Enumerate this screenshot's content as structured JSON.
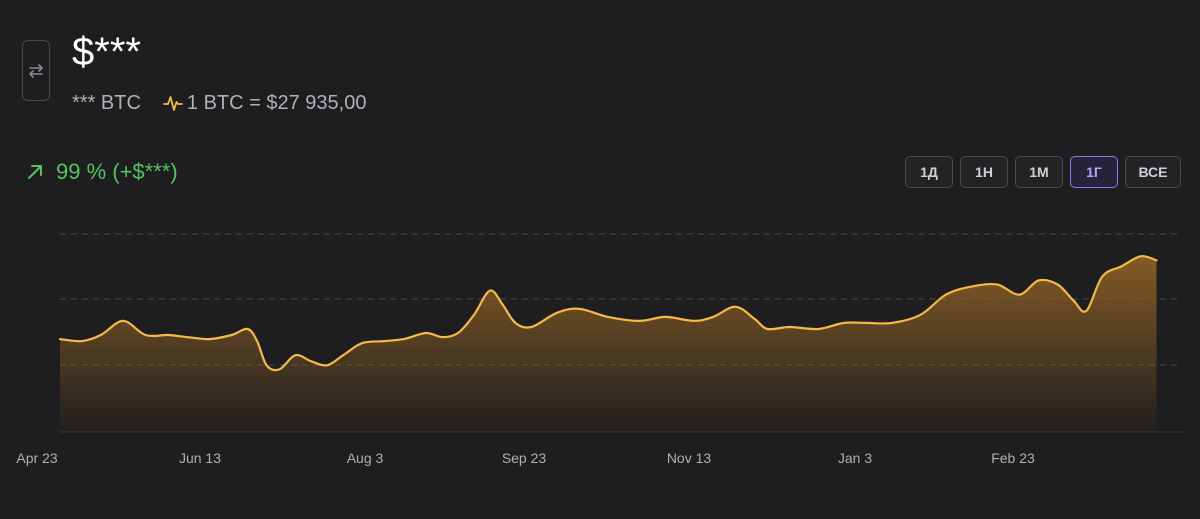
{
  "header": {
    "balance": "$***",
    "btc_amount": "*** BTC",
    "rate": "1 BTC = $27 935,00",
    "change": "99 % (+$***)"
  },
  "ranges": [
    {
      "label": "1Д",
      "active": false
    },
    {
      "label": "1Н",
      "active": false
    },
    {
      "label": "1М",
      "active": false
    },
    {
      "label": "1Г",
      "active": true
    },
    {
      "label": "ВСЕ",
      "active": false
    }
  ],
  "colors": {
    "line": "#f5b84a",
    "positive": "#53c45f",
    "accent": "#8b7ef0",
    "grid": "#4a4a4f"
  },
  "chart_data": {
    "type": "area",
    "title": "",
    "xlabel": "",
    "ylabel": "",
    "x_ticks": [
      "Apr 23",
      "Jun 13",
      "Aug 3",
      "Sep 23",
      "Nov 13",
      "Jan 3",
      "Feb 23"
    ],
    "x_tick_days": [
      0,
      51,
      102,
      153,
      204,
      255,
      306
    ],
    "x_range": [
      0,
      348
    ],
    "y_axis_labels": false,
    "grid": "horizontal dashed",
    "ylim": [
      0,
      100
    ],
    "points": [
      [
        7,
        46
      ],
      [
        14,
        45
      ],
      [
        20,
        48
      ],
      [
        27,
        55
      ],
      [
        34,
        48
      ],
      [
        41,
        48
      ],
      [
        47,
        47
      ],
      [
        54,
        46
      ],
      [
        61,
        48
      ],
      [
        66,
        51
      ],
      [
        69,
        45
      ],
      [
        72,
        33
      ],
      [
        76,
        31
      ],
      [
        81,
        38
      ],
      [
        86,
        35
      ],
      [
        91,
        33
      ],
      [
        96,
        38
      ],
      [
        102,
        44
      ],
      [
        109,
        45
      ],
      [
        115,
        46
      ],
      [
        122,
        49
      ],
      [
        127,
        47
      ],
      [
        132,
        49
      ],
      [
        137,
        58
      ],
      [
        142,
        70
      ],
      [
        146,
        63
      ],
      [
        150,
        54
      ],
      [
        155,
        52
      ],
      [
        163,
        59
      ],
      [
        170,
        61
      ],
      [
        179,
        57
      ],
      [
        189,
        55
      ],
      [
        197,
        57
      ],
      [
        206,
        55
      ],
      [
        212,
        57
      ],
      [
        219,
        62
      ],
      [
        225,
        56
      ],
      [
        229,
        51
      ],
      [
        236,
        52
      ],
      [
        245,
        51
      ],
      [
        253,
        54
      ],
      [
        260,
        54
      ],
      [
        268,
        54
      ],
      [
        277,
        58
      ],
      [
        285,
        68
      ],
      [
        293,
        72
      ],
      [
        301,
        73
      ],
      [
        308,
        68
      ],
      [
        314,
        75
      ],
      [
        320,
        73
      ],
      [
        325,
        65
      ],
      [
        329,
        60
      ],
      [
        334,
        77
      ],
      [
        340,
        82
      ],
      [
        346,
        87
      ],
      [
        351,
        85
      ]
    ]
  }
}
